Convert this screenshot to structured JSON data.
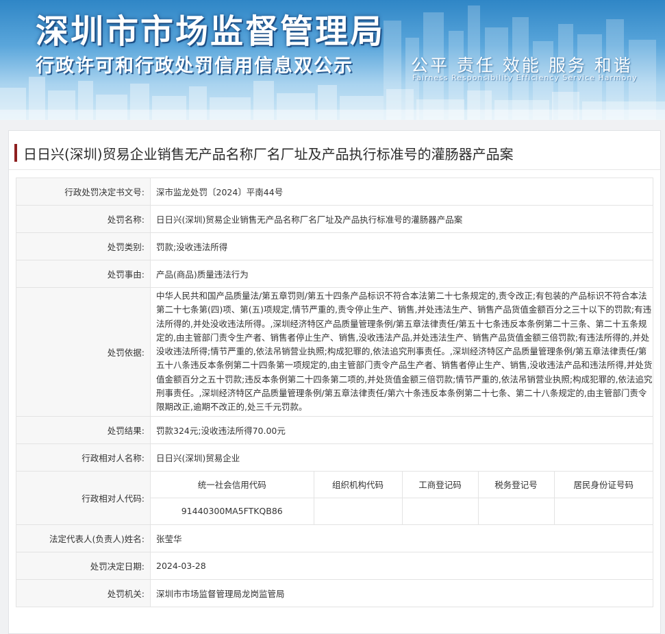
{
  "banner": {
    "agency": "深圳市市场监督管理局",
    "subtitle": "行政许可和行政处罚信用信息双公示",
    "slogan_cn": "公平  责任  效能  服务  和谐",
    "slogan_en": "Fairness  Responsibility  Efficiency  Service  Harmony"
  },
  "case": {
    "title": "日日兴(深圳)贸易企业销售无产品名称厂名厂址及产品执行标准号的灌肠器产品案"
  },
  "labels": {
    "doc_no": "行政处罚决定书文号:",
    "name": "处罚名称:",
    "category": "处罚类别:",
    "cause": "处罚事由:",
    "basis": "处罚依据:",
    "result": "处罚结果:",
    "party_name": "行政相对人名称:",
    "party_code": "行政相对人代码:",
    "legal_rep": "法定代表人(负责人)姓名:",
    "date": "处罚决定日期:",
    "authority": "处罚机关:"
  },
  "values": {
    "doc_no": "深市监龙处罚〔2024〕平南44号",
    "name": "日日兴(深圳)贸易企业销售无产品名称厂名厂址及产品执行标准号的灌肠器产品案",
    "category": "罚款;没收违法所得",
    "cause": "产品(商品)质量违法行为",
    "basis": "中华人民共和国产品质量法/第五章罚则/第五十四条产品标识不符合本法第二十七条规定的,责令改正;有包装的产品标识不符合本法第二十七条第(四)项、第(五)项规定,情节严重的,责令停止生产、销售,并处违法生产、销售产品货值金额百分之三十以下的罚款;有违法所得的,并处没收违法所得。,深圳经济特区产品质量管理条例/第五章法律责任/第五十七条违反本条例第二十三条、第二十五条规定的,由主管部门责令生产者、销售者停止生产、销售,没收违法产品,并处违法生产、销售产品货值金额三倍罚款;有违法所得的,并处没收违法所得;情节严重的,依法吊销营业执照;构成犯罪的,依法追究刑事责任。,深圳经济特区产品质量管理条例/第五章法律责任/第五十八条违反本条例第二十四条第一项规定的,由主管部门责令产品生产者、销售者停止生产、销售,没收违法产品和违法所得,并处货值金额百分之五十罚款;违反本条例第二十四条第二项的,并处货值金额三倍罚款;情节严重的,依法吊销营业执照;构成犯罪的,依法追究刑事责任。,深圳经济特区产品质量管理条例/第五章法律责任/第六十条违反本条例第二十七条、第二十八条规定的,由主管部门责令限期改正,逾期不改正的,处三千元罚款。",
    "result": "罚款324元;没收违法所得70.00元",
    "party_name": "日日兴(深圳)贸易企业",
    "legal_rep": "张莹华",
    "date": "2024-03-28",
    "authority": "深圳市市场监督管理局龙岗监管局"
  },
  "codes": {
    "headers": [
      "统一社会信用代码",
      "组织机构代码",
      "工商登记码",
      "税务登记号",
      "居民身份证号码"
    ],
    "values": [
      "91440300MA5FTKQB86",
      "",
      "",
      "",
      ""
    ]
  }
}
